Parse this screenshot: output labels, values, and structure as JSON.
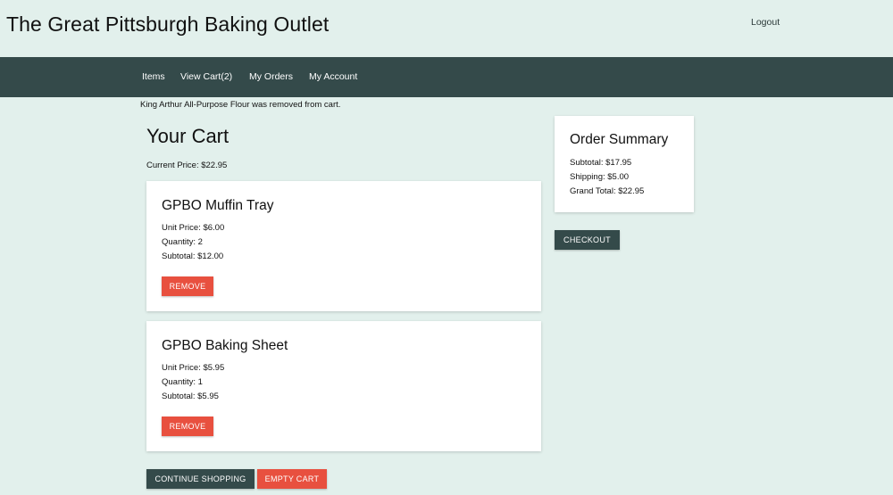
{
  "header": {
    "site_title": "The Great Pittsburgh Baking Outlet",
    "logout_label": "Logout"
  },
  "nav": {
    "items": [
      "Items",
      "View Cart(2)",
      "My Orders",
      "My Account"
    ]
  },
  "flash_message": "King Arthur All-Purpose Flour was removed from cart.",
  "cart": {
    "title": "Your Cart",
    "current_price": "Current Price: $22.95",
    "items": [
      {
        "name": "GPBO Muffin Tray",
        "unit_price": "Unit Price: $6.00",
        "quantity": "Quantity: 2",
        "subtotal": "Subtotal: $12.00",
        "remove_label": "REMOVE"
      },
      {
        "name": "GPBO Baking Sheet",
        "unit_price": "Unit Price: $5.95",
        "quantity": "Quantity: 1",
        "subtotal": "Subtotal: $5.95",
        "remove_label": "REMOVE"
      }
    ],
    "continue_label": "CONTINUE SHOPPING",
    "empty_label": "EMPTY CART"
  },
  "summary": {
    "title": "Order Summary",
    "subtotal": "Subtotal: $17.95",
    "shipping": "Shipping: $5.00",
    "grand_total": "Grand Total: $22.95",
    "checkout_label": "CHECKOUT"
  },
  "colors": {
    "background": "#e2f0ec",
    "navbar": "#344a4a",
    "danger": "#e8503f",
    "card": "#ffffff"
  }
}
